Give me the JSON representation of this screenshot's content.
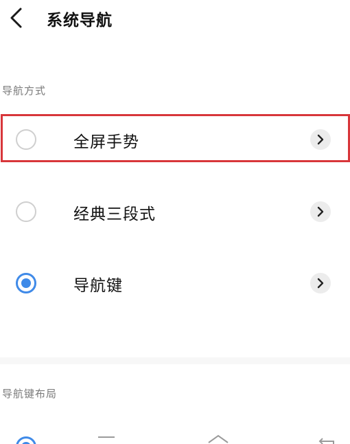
{
  "header": {
    "title": "系统导航",
    "back_icon": "chevron-left-icon"
  },
  "navigation_mode": {
    "section_label": "导航方式",
    "options": [
      {
        "label": "全屏手势",
        "selected": false,
        "highlighted": true
      },
      {
        "label": "经典三段式",
        "selected": false,
        "highlighted": false
      },
      {
        "label": "导航键",
        "selected": true,
        "highlighted": false
      }
    ]
  },
  "nav_key_layout": {
    "section_label": "导航键布局",
    "icons": [
      "menu-icon",
      "home-icon",
      "back-icon"
    ]
  },
  "colors": {
    "accent": "#3f8ae8",
    "highlight_border": "#d8363a",
    "section_text": "#7a7a7a"
  }
}
